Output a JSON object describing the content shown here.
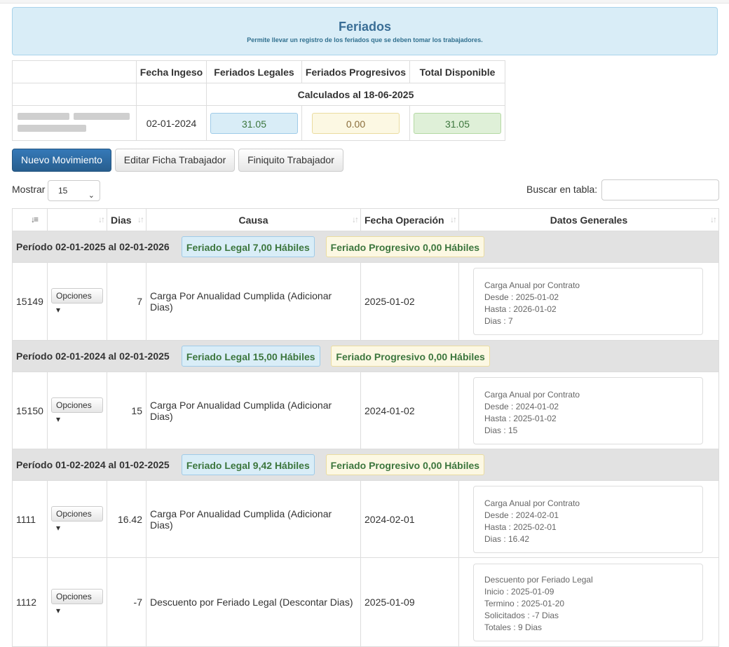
{
  "header": {
    "title": "Feriados",
    "subtitle": "Permite llevar un registro de los feriados que se deben tomar los trabajadores."
  },
  "summary": {
    "columns": [
      "Fecha Ingeso",
      "Feriados Legales",
      "Feriados Progresivos",
      "Total Disponible"
    ],
    "calculated_note": "Calculados al 18-06-2025",
    "fecha_ingreso": "02-01-2024",
    "legales": "31.05",
    "progresivos": "0.00",
    "total": "31.05"
  },
  "buttons": {
    "nuevo": "Nuevo Movimiento",
    "editar": "Editar Ficha Trabajador",
    "finiquito": "Finiquito Trabajador"
  },
  "controls": {
    "mostrar_label": "Mostrar",
    "mostrar_value": "15",
    "buscar_label": "Buscar en tabla:"
  },
  "table": {
    "headers": [
      "",
      "",
      "Dias",
      "Causa",
      "Fecha Operación",
      "Datos Generales"
    ],
    "groups": [
      {
        "periodo": "Período 02-01-2025 al 02-01-2026",
        "legal": "Feriado Legal 7,00 Hábiles",
        "progresivo": "Feriado Progresivo 0,00 Hábiles",
        "rows": [
          {
            "id": "15149",
            "opciones": "Opciones",
            "dias": "7",
            "causa": "Carga Por Anualidad Cumplida (Adicionar Dias)",
            "fecha": "2025-01-02",
            "datos": [
              "Carga Anual por Contrato",
              "Desde : 2025-01-02",
              "Hasta : 2026-01-02",
              "Dias : 7"
            ]
          }
        ]
      },
      {
        "periodo": "Período 02-01-2024 al 02-01-2025",
        "legal": "Feriado Legal 15,00 Hábiles",
        "progresivo": "Feriado Progresivo 0,00 Hábiles",
        "rows": [
          {
            "id": "15150",
            "opciones": "Opciones",
            "dias": "15",
            "causa": "Carga Por Anualidad Cumplida (Adicionar Dias)",
            "fecha": "2024-01-02",
            "datos": [
              "Carga Anual por Contrato",
              "Desde : 2024-01-02",
              "Hasta : 2025-01-02",
              "Dias : 15"
            ]
          }
        ]
      },
      {
        "periodo": "Período 01-02-2024 al 01-02-2025",
        "legal": "Feriado Legal 9,42 Hábiles",
        "progresivo": "Feriado Progresivo 0,00 Hábiles",
        "rows": [
          {
            "id": "1111",
            "opciones": "Opciones",
            "dias": "16.42",
            "causa": "Carga Por Anualidad Cumplida (Adicionar Dias)",
            "fecha": "2024-02-01",
            "datos": [
              "Carga Anual por Contrato",
              "Desde : 2024-02-01",
              "Hasta : 2025-02-01",
              "Dias : 16.42"
            ]
          },
          {
            "id": "1112",
            "opciones": "Opciones",
            "dias": "-7",
            "causa": "Descuento por Feriado Legal (Descontar Dias)",
            "fecha": "2025-01-09",
            "datos": [
              "Descuento por Feriado Legal",
              "Inicio : 2025-01-09",
              "Termino : 2025-01-20",
              "Solicitados : -7 Dias",
              "Totales : 9 Dias"
            ]
          }
        ]
      }
    ]
  }
}
